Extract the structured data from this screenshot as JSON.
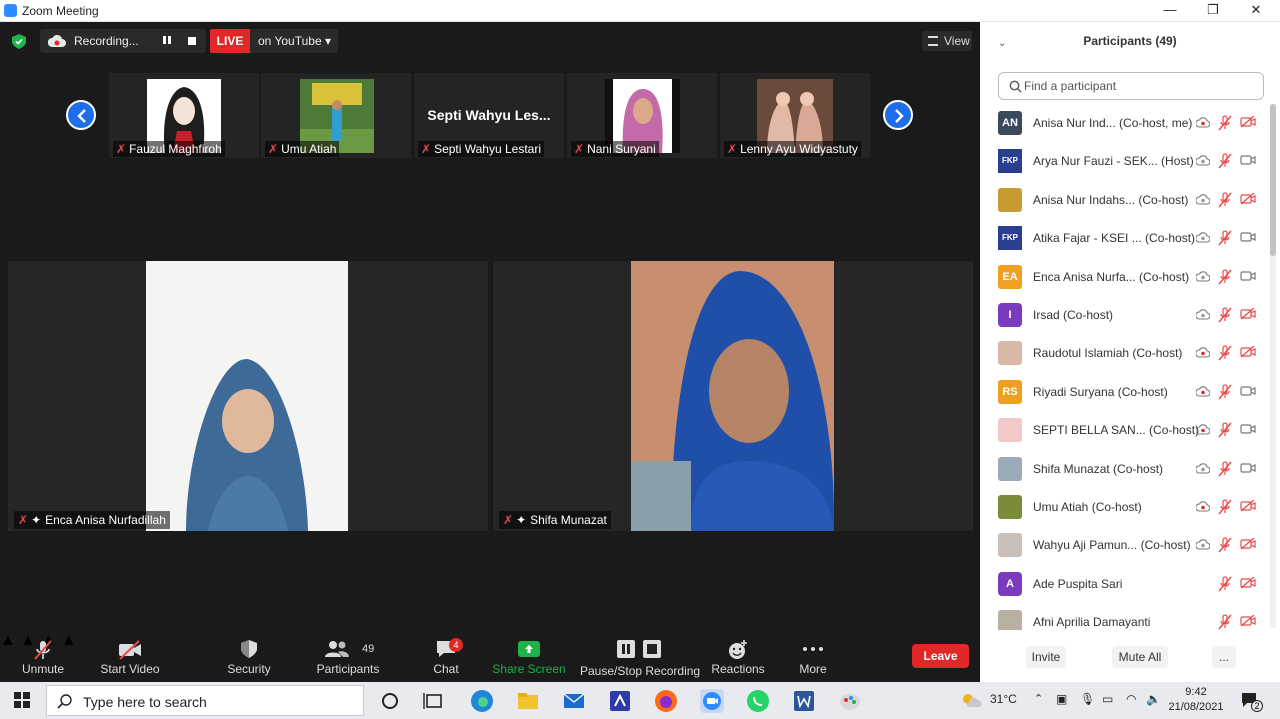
{
  "window": {
    "title": "Zoom Meeting",
    "minimize": "—",
    "maximize": "❐",
    "close": "✕"
  },
  "meeting_bar": {
    "recording_label": "Recording...",
    "live_label": "LIVE",
    "stream_label": "on YouTube ▾",
    "view_label": "View"
  },
  "thumbnails": [
    {
      "name": "Fauzul Maghfiroh",
      "muted": true
    },
    {
      "name": "Umu Atiah",
      "muted": true
    },
    {
      "name": "Septi Wahyu Lestari",
      "big_label": "Septi Wahyu Les...",
      "muted": true
    },
    {
      "name": "Nani Suryani",
      "muted": true
    },
    {
      "name": "Lenny Ayu Widyastuty",
      "muted": true
    }
  ],
  "tiles": [
    {
      "name": "Enca Anisa Nurfadillah",
      "muted": true,
      "pinned": true
    },
    {
      "name": "Shifa Munazat",
      "muted": true,
      "pinned": true
    }
  ],
  "toolbar": {
    "unmute": "Unmute",
    "start_video": "Start Video",
    "security": "Security",
    "participants": "Participants",
    "participants_count": "49",
    "chat": "Chat",
    "chat_badge": "4",
    "share_screen": "Share Screen",
    "pause_stop_recording": "Pause/Stop Recording",
    "reactions": "Reactions",
    "more": "More",
    "leave": "Leave"
  },
  "panel": {
    "title": "Participants (49)",
    "search_placeholder": "Find a participant",
    "invite": "Invite",
    "mute_all": "Mute All",
    "more": "...",
    "participants": [
      {
        "name": "Anisa Nur Ind...  (Co-host, me)",
        "avatar_text": "AN",
        "avatar_color": "#3a4a5c",
        "cloud_red": true,
        "video_off": true
      },
      {
        "name": "Arya Nur Fauzi - SEK...  (Host)",
        "avatar_text": "FKP",
        "avatar_color": "#2a3f8f",
        "cloud_red": false,
        "video_off": false
      },
      {
        "name": "Anisa Nur Indahs...  (Co-host)",
        "avatar_text": "",
        "avatar_color": "#c89a30",
        "cloud_red": false,
        "video_off": true
      },
      {
        "name": "Atika Fajar - KSEI ...  (Co-host)",
        "avatar_text": "FKP",
        "avatar_color": "#2a3f8f",
        "cloud_red": false,
        "video_off": false
      },
      {
        "name": "Enca Anisa Nurfa...  (Co-host)",
        "avatar_text": "EA",
        "avatar_color": "#f0a020",
        "cloud_red": false,
        "video_off": false
      },
      {
        "name": "Irsad (Co-host)",
        "avatar_text": "I",
        "avatar_color": "#7b3bbf",
        "cloud_red": false,
        "video_off": true
      },
      {
        "name": "Raudotul Islamiah (Co-host)",
        "avatar_text": "",
        "avatar_color": "#d9b8a8",
        "cloud_red": true,
        "video_off": true
      },
      {
        "name": "Riyadi Suryana (Co-host)",
        "avatar_text": "RS",
        "avatar_color": "#f0a020",
        "cloud_red": true,
        "video_off": false
      },
      {
        "name": "SEPTI BELLA SAN...  (Co-host)",
        "avatar_text": "",
        "avatar_color": "#f2c8c8",
        "cloud_red": true,
        "video_off": false
      },
      {
        "name": "Shifa Munazat (Co-host)",
        "avatar_text": "",
        "avatar_color": "#9aaab8",
        "cloud_red": false,
        "video_off": false
      },
      {
        "name": "Umu Atiah (Co-host)",
        "avatar_text": "",
        "avatar_color": "#7a8c3a",
        "cloud_red": true,
        "video_off": true
      },
      {
        "name": "Wahyu Aji Pamun...  (Co-host)",
        "avatar_text": "",
        "avatar_color": "#c8c0b8",
        "cloud_red": false,
        "video_off": true
      },
      {
        "name": "Ade Puspita Sari",
        "avatar_text": "A",
        "avatar_color": "#7b3bbf",
        "cloud_red": null,
        "video_off": true
      },
      {
        "name": "Afni Aprilia Damayanti",
        "avatar_text": "",
        "avatar_color": "#b8b0a0",
        "cloud_red": null,
        "video_off": true
      }
    ]
  },
  "taskbar": {
    "search_text": "Type here to search",
    "weather": "31°C",
    "time": "9:42",
    "date": "21/08/2021",
    "notification_count": "2"
  },
  "colors": {
    "accent_blue": "#2d8cff",
    "live_red": "#e02828",
    "muted_red": "#e84a4a",
    "share_green": "#1fb24a"
  }
}
